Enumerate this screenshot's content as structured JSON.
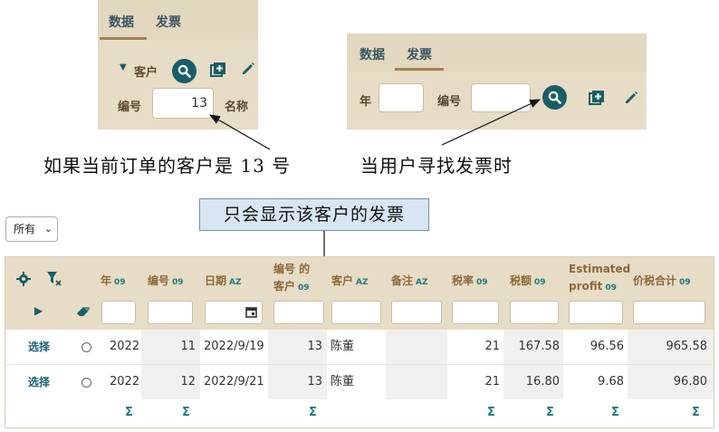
{
  "left_panel": {
    "tabs": [
      "数据",
      "发票"
    ],
    "active_tab": 0,
    "customer_label": "客户",
    "number_label": "编号",
    "number_value": "13",
    "name_label": "名称"
  },
  "right_panel": {
    "tabs": [
      "数据",
      "发票"
    ],
    "active_tab": 1,
    "year_label": "年",
    "number_label": "编号"
  },
  "annotations": {
    "left_note": "如果当前订单的客户是 13 号",
    "right_note": "当用户寻找发票时",
    "callout": "只会显示该客户的发票"
  },
  "filter_select": {
    "value": "所有",
    "caret": "⌄"
  },
  "table": {
    "columns": [
      {
        "label": "年",
        "sort": "09"
      },
      {
        "label": "编号",
        "sort": "09"
      },
      {
        "label": "日期",
        "sort": "AZ"
      },
      {
        "label": "编号 的",
        "label2": "客户",
        "sort": "09"
      },
      {
        "label": "客户",
        "sort": "AZ"
      },
      {
        "label": "备注",
        "sort": "AZ"
      },
      {
        "label": "税率",
        "sort": "09"
      },
      {
        "label": "税额",
        "sort": "09"
      },
      {
        "label": "Estimated",
        "label2": "profit",
        "sort": "09"
      },
      {
        "label": "价税合计",
        "sort": "09"
      }
    ],
    "select_label": "选择",
    "rows": [
      {
        "year": "2022",
        "number": "11",
        "date": "2022/9/19",
        "customer_number": "13",
        "customer": "陈董",
        "note": "",
        "tax_rate": "21",
        "tax": "167.58",
        "profit": "96.56",
        "total": "965.58"
      },
      {
        "year": "2022",
        "number": "12",
        "date": "2022/9/21",
        "customer_number": "13",
        "customer": "陈董",
        "note": "",
        "tax_rate": "21",
        "tax": "16.80",
        "profit": "9.68",
        "total": "96.80"
      }
    ],
    "sum_symbol": "Σ"
  },
  "colors": {
    "accent": "#175f66",
    "header_bg": "#e7dcc6",
    "tab_underline": "#a08350"
  }
}
